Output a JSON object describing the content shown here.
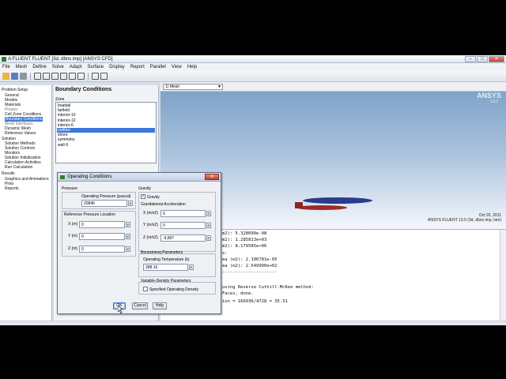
{
  "window": {
    "title": "A:FLUENT FLUENT [3d, dbns imp] [ANSYS CFD]"
  },
  "menu": [
    "File",
    "Mesh",
    "Define",
    "Solve",
    "Adapt",
    "Surface",
    "Display",
    "Report",
    "Parallel",
    "View",
    "Help"
  ],
  "tree": {
    "items": [
      {
        "label": "Problem Setup",
        "grey": false,
        "sel": false
      },
      {
        "label": "General",
        "grey": false,
        "sel": false
      },
      {
        "label": "Models",
        "grey": false,
        "sel": false
      },
      {
        "label": "Materials",
        "grey": false,
        "sel": false
      },
      {
        "label": "Phases",
        "grey": true,
        "sel": false
      },
      {
        "label": "Cell Zone Conditions",
        "grey": false,
        "sel": false
      },
      {
        "label": "Boundary Conditions",
        "grey": false,
        "sel": true
      },
      {
        "label": "Mesh Interfaces",
        "grey": true,
        "sel": false
      },
      {
        "label": "Dynamic Mesh",
        "grey": false,
        "sel": false
      },
      {
        "label": "Reference Values",
        "grey": false,
        "sel": false
      },
      {
        "label": "Solution",
        "grey": false,
        "sel": false
      },
      {
        "label": "Solution Methods",
        "grey": false,
        "sel": false
      },
      {
        "label": "Solution Controls",
        "grey": false,
        "sel": false
      },
      {
        "label": "Monitors",
        "grey": false,
        "sel": false
      },
      {
        "label": "Solution Initialization",
        "grey": false,
        "sel": false
      },
      {
        "label": "Calculation Activities",
        "grey": false,
        "sel": false
      },
      {
        "label": "Run Calculation",
        "grey": false,
        "sel": false
      },
      {
        "label": "Results",
        "grey": false,
        "sel": false
      },
      {
        "label": "Graphics and Animations",
        "grey": false,
        "sel": false
      },
      {
        "label": "Plots",
        "grey": false,
        "sel": false
      },
      {
        "label": "Reports",
        "grey": false,
        "sel": false
      }
    ]
  },
  "boundary": {
    "title": "Boundary Conditions",
    "zone_label": "Zone",
    "zones": [
      "boattail",
      "farfield",
      "interior-10",
      "interior-12",
      "interior-6",
      "outflow",
      "shore",
      "symmetry",
      "wall-9"
    ],
    "selected_index": 5
  },
  "graphics": {
    "window_select": "1) Mesh",
    "logo": "ANSYS",
    "logo_sub": "13.0",
    "date": "Oct 26, 2011",
    "solver_info": "ANSYS FLUENT 13.0 (3d, dbns imp, lam)"
  },
  "console": {
    "lines": [
      "m2): 5.328090e-08",
      "m2): 1.285813e+03",
      "m2): 8.179585e+06",
      "s:",
      "ea (m2): 2.106781e-05",
      "ea (m2): 2.549990e+02",
      "---------------------",
      "",
      " using Reverse Cuthill-McKee method:",
      "Faces, done.",
      "ion = 166936/4728 = 35.31"
    ]
  },
  "dialog": {
    "title": "Operating Conditions",
    "pressure_group": "Pressure",
    "op_pressure_label": "Operating Pressure (pascal)",
    "op_pressure_value": "20846",
    "ref_loc_label": "Reference Pressure Location",
    "x_label": "X (m)",
    "x_value": "0",
    "y_label": "Y (m)",
    "y_value": "0",
    "z_label": "Z (m)",
    "z_value": "0",
    "gravity_group": "Gravity",
    "gravity_check": "Gravity",
    "grav_accel_label": "Gravitational Acceleration",
    "gx_label": "X (m/s2)",
    "gx_value": "0",
    "gy_label": "Y (m/s2)",
    "gy_value": "0",
    "gz_label": "Z (m/s2)",
    "gz_value": "-9.807",
    "boussinesq_label": "Boussinesq Parameters",
    "op_temp_label": "Operating Temperature (k)",
    "op_temp_value": "288.16",
    "var_density_label": "Variable-Density Parameters",
    "spec_density_label": "Specified Operating Density",
    "p_label": "P",
    "ok": "OK",
    "cancel": "Cancel",
    "help": "Help"
  }
}
